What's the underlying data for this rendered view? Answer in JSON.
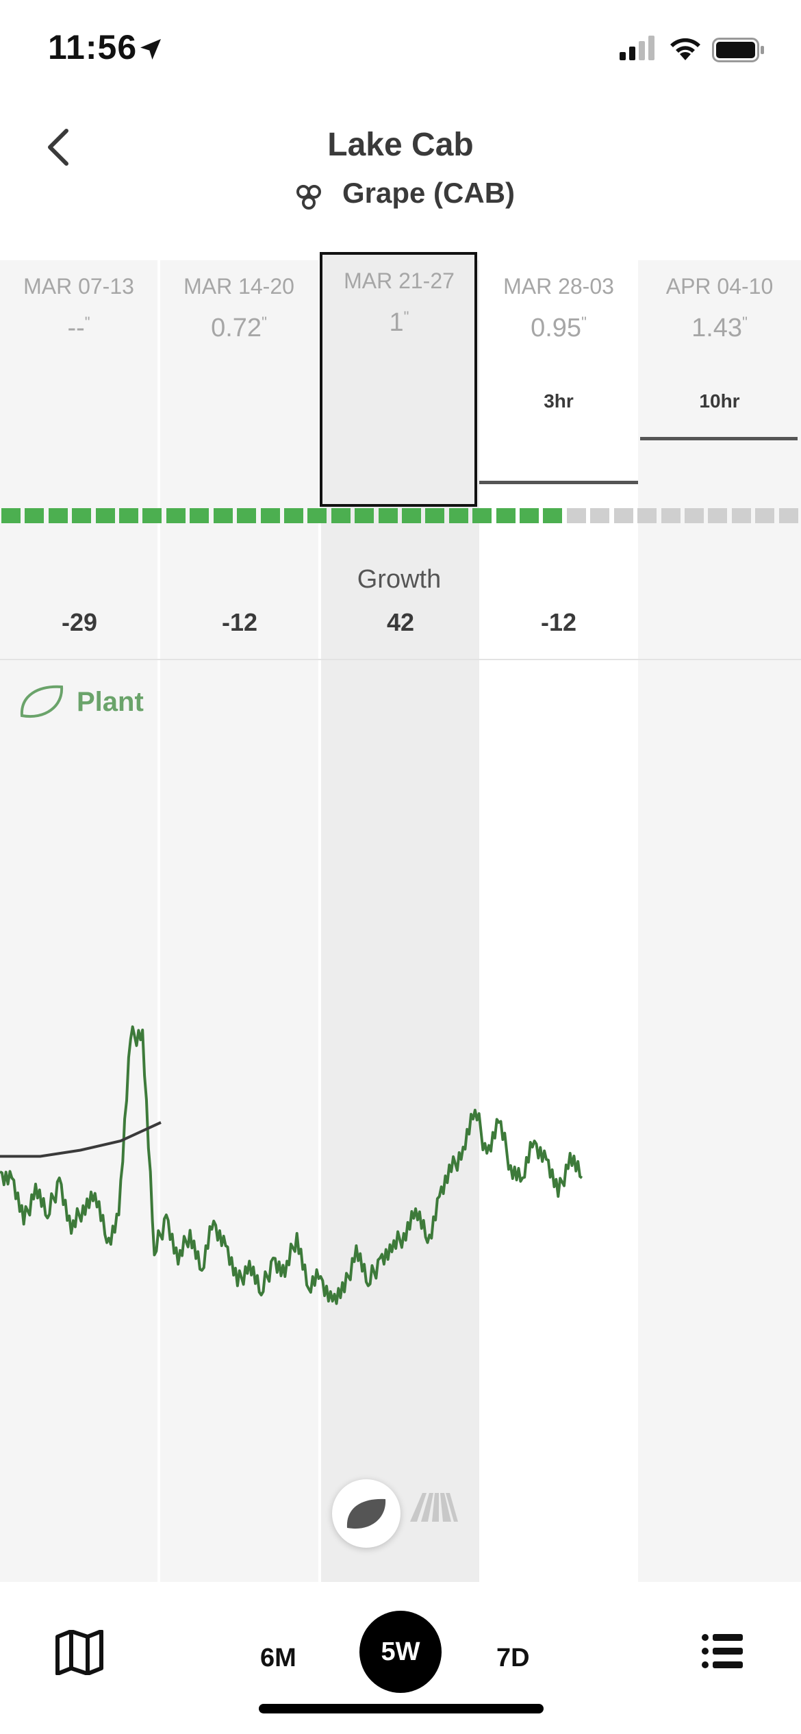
{
  "status_bar": {
    "time": "11:56",
    "icons": [
      "location-arrow-icon",
      "cellular-signal-icon",
      "wifi-icon",
      "battery-icon"
    ]
  },
  "header": {
    "title": "Lake Cab",
    "back_icon": "chevron-left-icon",
    "crop_icon": "grape-icon",
    "crop_label": "Grape (CAB)"
  },
  "weeks": [
    {
      "date": "MAR 07-13",
      "rain": "--",
      "duration": ""
    },
    {
      "date": "MAR 14-20",
      "rain": "0.72",
      "duration": ""
    },
    {
      "date": "MAR 21-27",
      "rain": "1",
      "duration": "",
      "selected": true
    },
    {
      "date": "MAR 28-03",
      "rain": "0.95",
      "duration": "3hr"
    },
    {
      "date": "APR 04-10",
      "rain": "1.43",
      "duration": "10hr"
    }
  ],
  "rain_unit": "\"",
  "growth": {
    "label": "Growth",
    "values": [
      "-29",
      "-12",
      "42",
      "-12",
      ""
    ]
  },
  "colors": {
    "growth_green": "#4caf50",
    "growth_grey": "#cfcfcf",
    "plant_line": "#3d7a3a",
    "threshold_line": "#3a3a3a",
    "plant_legend": "#6aa36a"
  },
  "plant_legend": {
    "icon": "leaf-icon",
    "label": "Plant"
  },
  "growth_strip": {
    "filled_fraction": 0.71
  },
  "chart_data": {
    "type": "line",
    "xlabel": "",
    "ylabel": "",
    "x_categories": [
      "MAR 07-13",
      "MAR 14-20",
      "MAR 21-27",
      "MAR 28-03",
      "APR 04-10"
    ],
    "series": [
      {
        "role": "plant-signal",
        "values": [
          0.42,
          0.4,
          0.25,
          0.38,
          0.27,
          0.4,
          0.22,
          0.31,
          0.35,
          0.19,
          0.28,
          0.85,
          0.88,
          0.15,
          0.28,
          0.12,
          0.23,
          0.1,
          0.26,
          0.18,
          0.05,
          0.13,
          0.02,
          0.14,
          0.08,
          0.22,
          0.04,
          0.08,
          0.0,
          0.03,
          0.18,
          0.05,
          0.14,
          0.16,
          0.22,
          0.3,
          0.19,
          0.34,
          0.42,
          0.5,
          0.62,
          0.48,
          0.58,
          0.44,
          0.4,
          0.52,
          0.46,
          0.34,
          0.48,
          0.4
        ]
      },
      {
        "role": "threshold",
        "values": [
          0.47,
          0.47,
          0.49,
          0.52,
          0.58
        ]
      }
    ],
    "ylim": [
      0,
      1
    ]
  },
  "overlay_buttons": {
    "leaf_icon": "leaf-icon",
    "road_icon": "road-icon"
  },
  "bottom_nav": {
    "map_icon": "map-icon",
    "ranges": [
      "6M",
      "5W",
      "7D"
    ],
    "active_range": "5W",
    "list_icon": "list-icon"
  }
}
